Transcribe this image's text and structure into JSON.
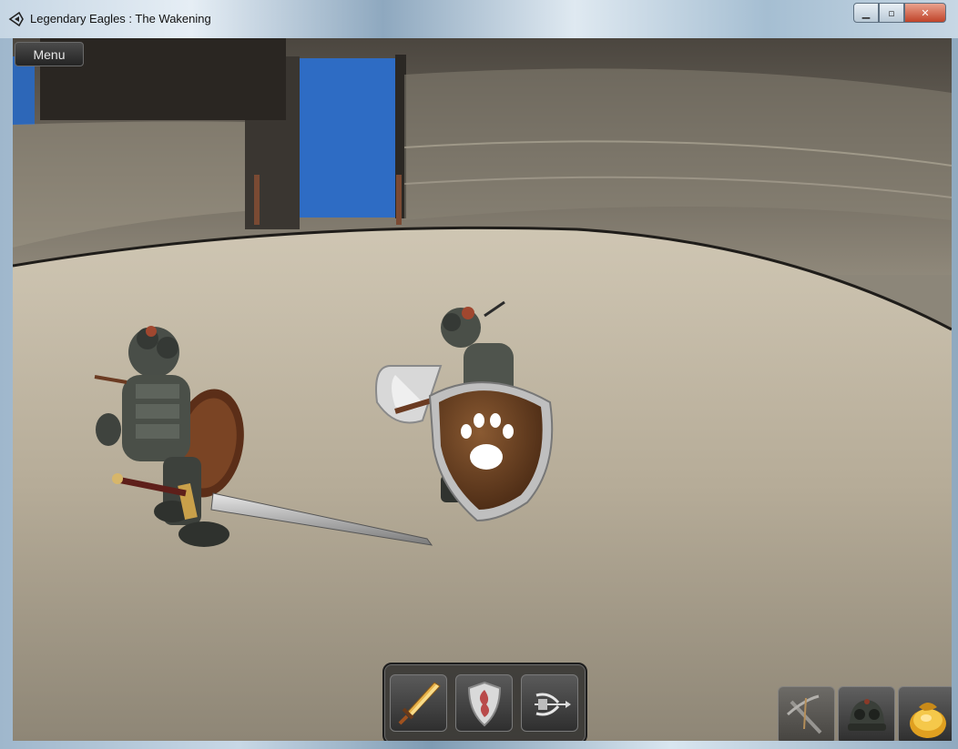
{
  "window": {
    "title": "Legendary Eagles : The Wakening",
    "minimize_icon": "minimize-icon",
    "maximize_icon": "maximize-icon",
    "close_icon": "close-icon"
  },
  "menu": {
    "label": "Menu"
  },
  "hotbar": {
    "slots": [
      {
        "icon": "sword-icon"
      },
      {
        "icon": "shield-icon"
      },
      {
        "icon": "bow-icon"
      }
    ]
  },
  "equipment": {
    "slots": [
      {
        "icon": "crossbow-icon"
      },
      {
        "icon": "helmet-icon"
      },
      {
        "icon": "gold-pouch-icon"
      }
    ]
  },
  "colors": {
    "floor": "#b4ab98",
    "wall": "#6f695e",
    "sky": "#2f6bbf",
    "shield_wood": "#6a3e1f",
    "armor": "#444a44"
  }
}
